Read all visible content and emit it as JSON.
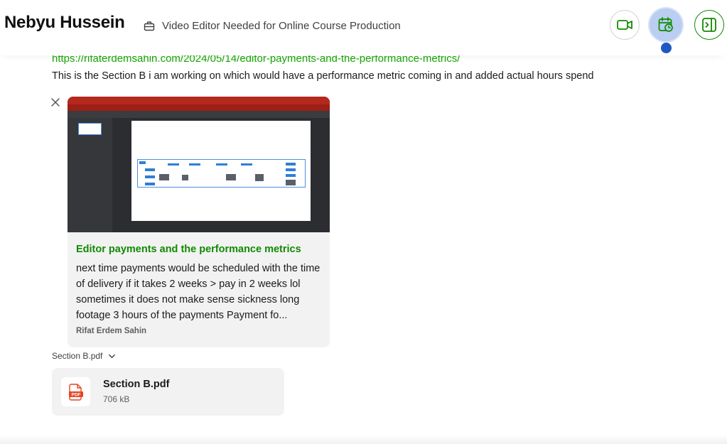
{
  "header": {
    "contact_name": "Nebyu Hussein",
    "job_title": "Video Editor Needed for Online Course Production",
    "icons": {
      "job": "briefcase-icon",
      "video": "video-camera-icon",
      "calendar": "calendar-clock-icon",
      "sidebar": "sidebar-toggle-icon"
    },
    "colors": {
      "green": "#108a00",
      "calendar_bg": "#b9cef0",
      "dot": "#1f57c3"
    }
  },
  "message": {
    "link_url": "https://rifaterdemsahin.com/2024/05/14/editor-payments-and-the-performance-metrics/",
    "text": "This is the Section B i am working on which would have a performance metric coming in and added actual hours spend"
  },
  "link_preview": {
    "title": "Editor payments and the performance metrics",
    "excerpt": "next time payments would be scheduled with the time of delivery if it takes 2 weeks > pay in 2 weeks lol sometimes it does not make sense sickness long footage 3 hours of the payments Payment fo...",
    "author": "Rifat Erdem Sahin"
  },
  "attachment": {
    "section_label": "Section B.pdf",
    "file_name": "Section B.pdf",
    "file_size": "706 kB",
    "file_type_label": "PDF"
  }
}
